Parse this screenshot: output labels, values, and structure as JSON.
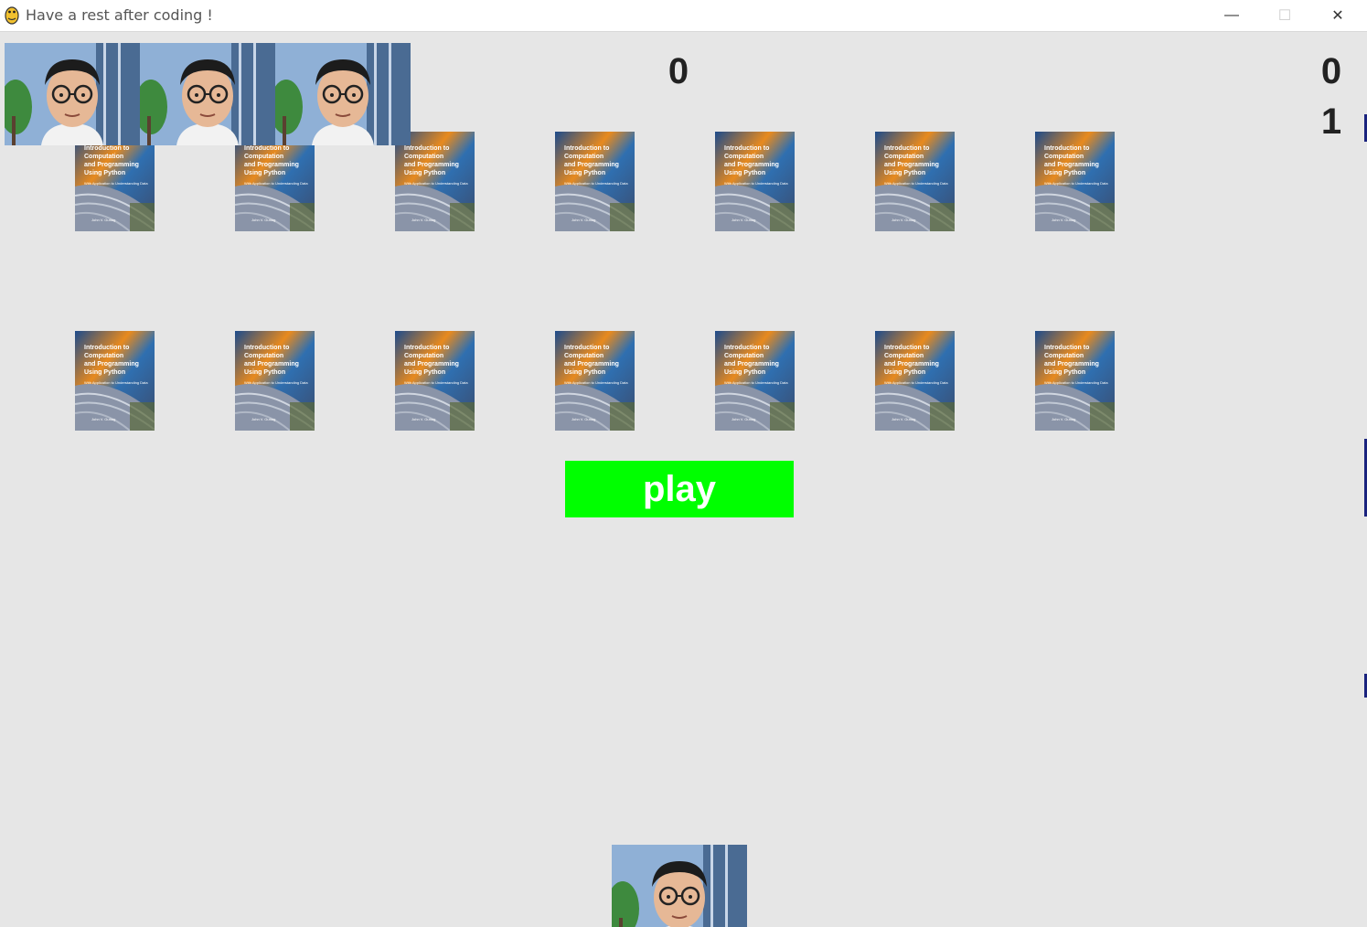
{
  "window": {
    "title": "Have a rest after coding !",
    "minimize_glyph": "—",
    "maximize_glyph": "☐",
    "close_glyph": "✕"
  },
  "game": {
    "lives_icon": "face-photo-icon",
    "lives_count": 3,
    "score_center": "0",
    "score_right": "0",
    "level_right": "1",
    "brick_icon": "book-cover-icon",
    "brick_rows": 2,
    "bricks_per_row": 7,
    "book_cover_lines": [
      "Introduction to",
      "Computation",
      "and Programming",
      "Using Python"
    ],
    "play_button_label": "play",
    "play_button_color": "#00ff00",
    "paddle_icon": "face-photo-icon"
  },
  "colors": {
    "background": "#e6e6e6",
    "score_text": "#222222",
    "play_text": "#ffffff"
  }
}
